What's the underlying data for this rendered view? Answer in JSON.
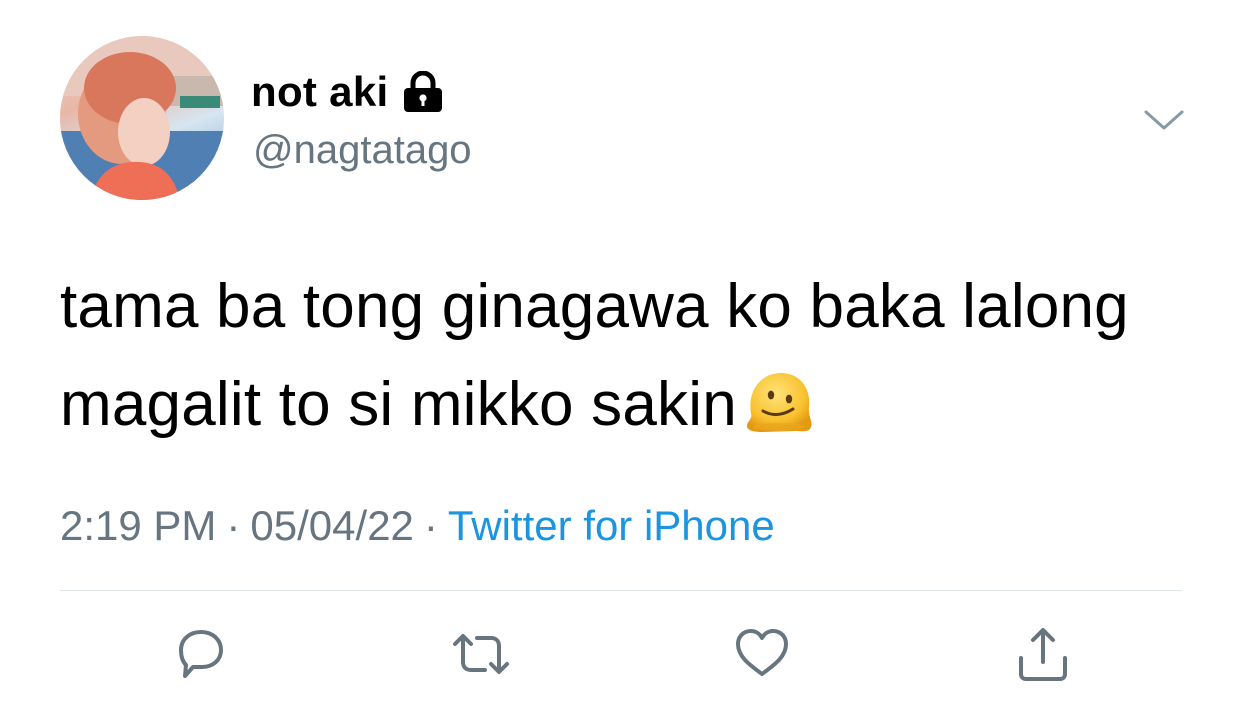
{
  "author": {
    "display_name": "not aki",
    "handle": "@nagtatago",
    "protected": true,
    "avatar_icon": "avatar-photo"
  },
  "tweet": {
    "text_lines": [
      "tama ba tong ginagawa ko baka lalong",
      "magalit to si mikko sakin"
    ],
    "emoji": "melting-face-emoji"
  },
  "meta": {
    "time": "2:19 PM",
    "separator": "·",
    "date": "05/04/22",
    "source": "Twitter for iPhone"
  },
  "actions": {
    "icons": [
      "reply-icon",
      "retweet-icon",
      "like-icon",
      "share-icon"
    ]
  },
  "colors": {
    "secondary_text": "#66757f",
    "link": "#1b95e0",
    "divider": "#dfe4e8",
    "icon": "#66757f"
  }
}
